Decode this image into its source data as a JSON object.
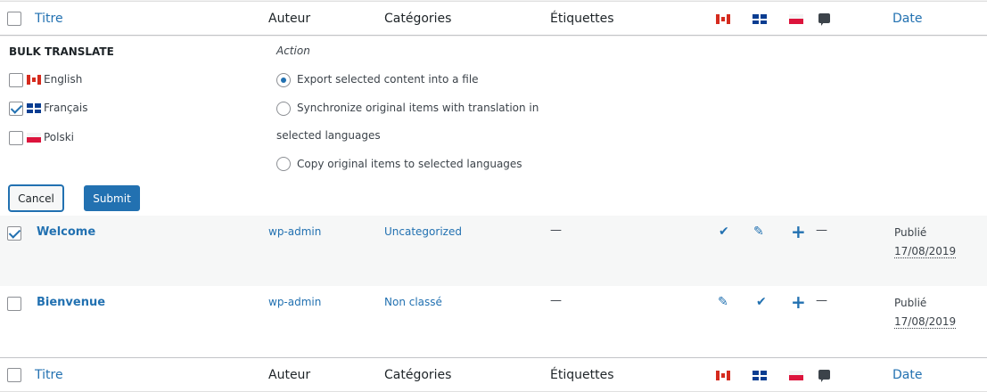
{
  "table": {
    "columns": {
      "title": "Titre",
      "author": "Auteur",
      "categories": "Catégories",
      "tags": "Étiquettes",
      "date": "Date"
    },
    "language_icons": [
      "flag-canada-icon",
      "flag-quebec-icon",
      "flag-poland-icon",
      "comments-icon"
    ]
  },
  "bulk_translate": {
    "heading": "BULK TRANSLATE",
    "languages": [
      {
        "label": "English",
        "checked": false,
        "flag": "flag-canada-icon"
      },
      {
        "label": "Français",
        "checked": true,
        "flag": "flag-quebec-icon"
      },
      {
        "label": "Polski",
        "checked": false,
        "flag": "flag-poland-icon"
      }
    ],
    "action_label": "Action",
    "actions": [
      {
        "label": "Export selected content into a file",
        "selected": true
      },
      {
        "label_line1": "Synchronize original items with translation in",
        "label_line2": "selected languages",
        "selected": false
      },
      {
        "label": "Copy original items to selected languages",
        "selected": false
      }
    ],
    "cancel_label": "Cancel",
    "submit_label": "Submit"
  },
  "rows": [
    {
      "checked": true,
      "title": "Welcome",
      "author": "wp-admin",
      "category": "Uncategorized",
      "tags": "—",
      "lang_icons": [
        "check-icon",
        "pencil-icon",
        "plus-icon"
      ],
      "comments": "—",
      "status": "Publié",
      "date": "17/08/2019"
    },
    {
      "checked": false,
      "title": "Bienvenue",
      "author": "wp-admin",
      "category": "Non classé",
      "tags": "—",
      "lang_icons": [
        "pencil-icon",
        "check-icon",
        "plus-icon"
      ],
      "comments": "—",
      "status": "Publié",
      "date": "17/08/2019"
    }
  ],
  "colors": {
    "link": "#2271b1",
    "text": "#3c434a",
    "row_alt": "#f6f7f7"
  }
}
